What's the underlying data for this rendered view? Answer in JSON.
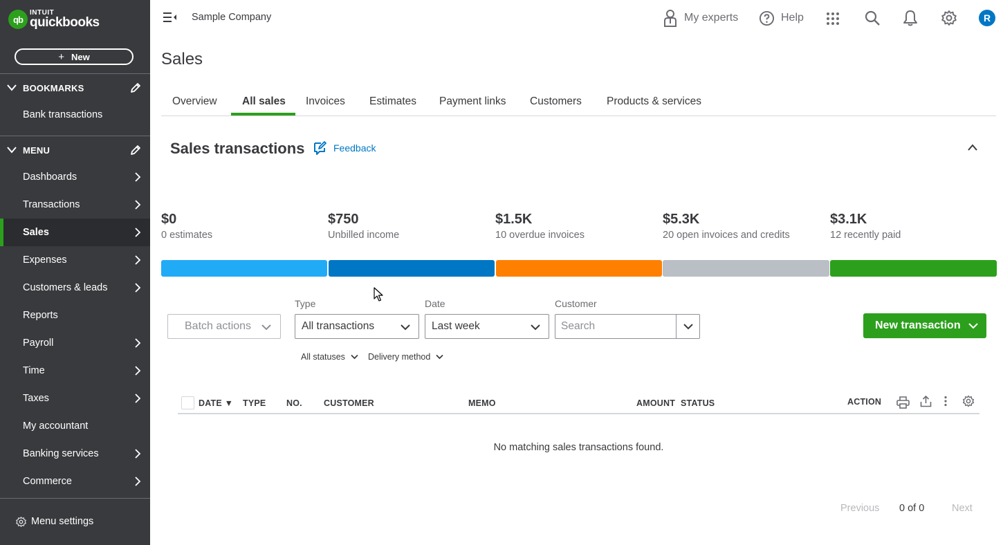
{
  "sidebar": {
    "logo_intuit": "INTUIT",
    "logo_product": "quickbooks",
    "logo_mark": "qb",
    "new_label": "New",
    "bookmarks_label": "BOOKMARKS",
    "bookmarks": [
      {
        "label": "Bank transactions"
      }
    ],
    "menu_label": "MENU",
    "items": [
      {
        "label": "Dashboards",
        "has_arrow": true
      },
      {
        "label": "Transactions",
        "has_arrow": true
      },
      {
        "label": "Sales",
        "has_arrow": true,
        "active": true
      },
      {
        "label": "Expenses",
        "has_arrow": true
      },
      {
        "label": "Customers & leads",
        "has_arrow": true
      },
      {
        "label": "Reports",
        "has_arrow": false
      },
      {
        "label": "Payroll",
        "has_arrow": true
      },
      {
        "label": "Time",
        "has_arrow": true
      },
      {
        "label": "Taxes",
        "has_arrow": true
      },
      {
        "label": "My accountant",
        "has_arrow": false
      },
      {
        "label": "Banking services",
        "has_arrow": true
      },
      {
        "label": "Commerce",
        "has_arrow": true
      }
    ],
    "menu_settings_label": "Menu settings"
  },
  "topbar": {
    "company": "Sample Company",
    "my_experts": "My experts",
    "help": "Help",
    "avatar_initial": "R"
  },
  "page": {
    "title": "Sales",
    "tabs": [
      {
        "label": "Overview"
      },
      {
        "label": "All sales",
        "active": true
      },
      {
        "label": "Invoices"
      },
      {
        "label": "Estimates"
      },
      {
        "label": "Payment links"
      },
      {
        "label": "Customers"
      },
      {
        "label": "Products & services"
      }
    ]
  },
  "section": {
    "title": "Sales transactions",
    "feedback": "Feedback"
  },
  "stats": [
    {
      "value": "$0",
      "label": "0 estimates",
      "color": "#21abf6"
    },
    {
      "value": "$750",
      "label": "Unbilled income",
      "color": "#0077c5"
    },
    {
      "value": "$1.5K",
      "label": "10 overdue invoices",
      "color": "#ff8000"
    },
    {
      "value": "$5.3K",
      "label": "20 open invoices and credits",
      "color": "#babec5"
    },
    {
      "value": "$3.1K",
      "label": "12 recently paid",
      "color": "#2ca01c"
    }
  ],
  "filters": {
    "batch_actions": "Batch actions",
    "type_label": "Type",
    "type_value": "All transactions",
    "date_label": "Date",
    "date_value": "Last week",
    "customer_label": "Customer",
    "customer_placeholder": "Search",
    "all_statuses": "All statuses",
    "delivery_method": "Delivery method",
    "new_transaction": "New transaction"
  },
  "table": {
    "columns": [
      "DATE ▼",
      "TYPE",
      "NO.",
      "CUSTOMER",
      "MEMO",
      "AMOUNT",
      "STATUS",
      "ACTION"
    ],
    "empty_message": "No matching sales transactions found."
  },
  "pagination": {
    "previous": "Previous",
    "count": "0 of 0",
    "next": "Next"
  },
  "colors": {
    "brand_green": "#2ca01c",
    "link_blue": "#0077c5",
    "sidebar_bg": "#393a3d"
  }
}
